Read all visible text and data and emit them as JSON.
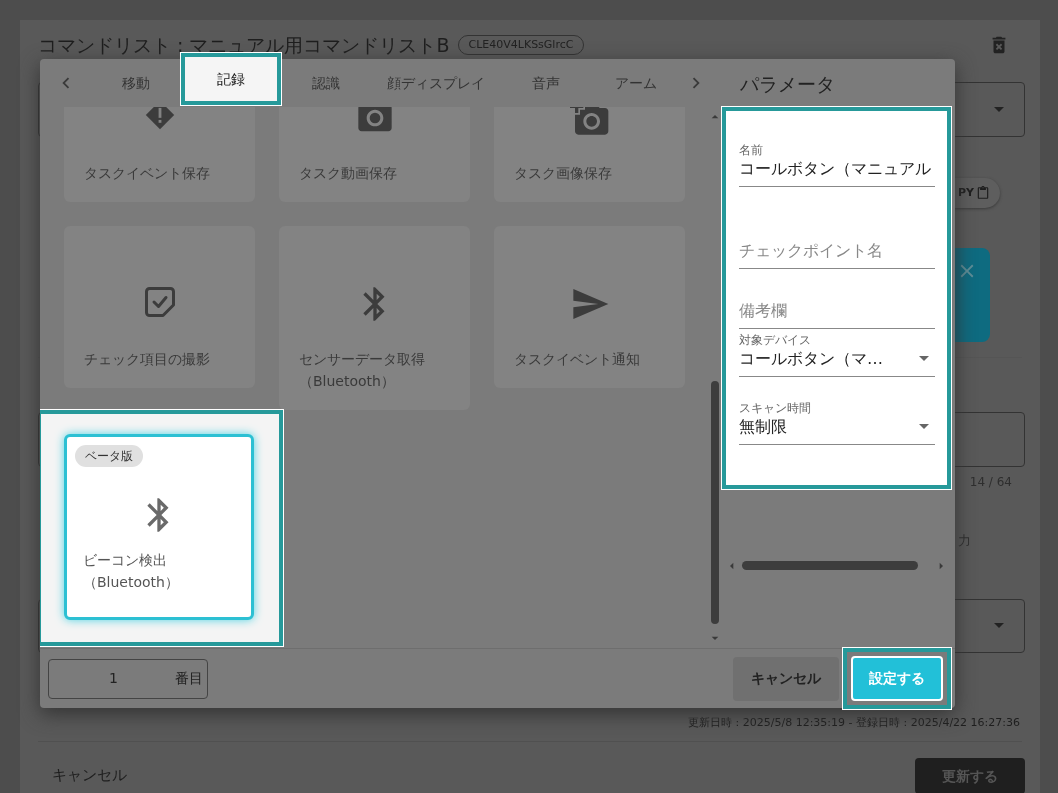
{
  "page": {
    "title": "コマンドリスト : マニュアル用コマンドリストB",
    "id_chip": "CLE40V4LKSsGlrcC",
    "copy_chip": "PY",
    "char_count": "14 / 64",
    "partial_label": "力",
    "timestamps": "更新日時 : 2025/5/8 12:35:19 - 登録日時 : 2025/4/22 16:27:36",
    "cancel_link": "キャンセル",
    "update_button": "更新する"
  },
  "dialog": {
    "tabs": [
      {
        "label": "移動",
        "selected": false
      },
      {
        "label": "記録",
        "selected": true
      },
      {
        "label": "認識",
        "selected": false
      },
      {
        "label": "顔ディスプレイ",
        "selected": false
      },
      {
        "label": "音声",
        "selected": false
      },
      {
        "label": "アーム",
        "selected": false
      }
    ],
    "commands": [
      {
        "label_lines": [
          "タスクイベント保存"
        ],
        "kind": "alert",
        "selected": false
      },
      {
        "label_lines": [
          "タスク動画保存"
        ],
        "kind": "camera",
        "selected": false
      },
      {
        "label_lines": [
          "タスク画像保存"
        ],
        "kind": "camera_add",
        "selected": false
      },
      {
        "label_lines": [
          "チェック項目の撮影"
        ],
        "kind": "check_note",
        "selected": false
      },
      {
        "label_lines": [
          "センサーデータ取得",
          "（Bluetooth）"
        ],
        "kind": "bluetooth",
        "selected": false
      },
      {
        "label_lines": [
          "タスクイベント通知"
        ],
        "kind": "send",
        "selected": false
      },
      {
        "label_lines": [
          "ビーコン検出",
          "（Bluetooth）"
        ],
        "kind": "bluetooth",
        "selected": true,
        "badge": "ベータ版"
      }
    ],
    "parameters": {
      "title": "パラメータ",
      "fields": [
        {
          "kind": "text",
          "label": "名前",
          "value": "コールボタン（マニュアル"
        },
        {
          "kind": "text",
          "placeholder": "チェックポイント名"
        },
        {
          "kind": "text",
          "placeholder": "備考欄"
        },
        {
          "kind": "select",
          "label": "対象デバイス",
          "value": "コールボタン（マ…"
        },
        {
          "kind": "select",
          "label": "スキャン時間",
          "value": "無制限"
        }
      ]
    },
    "position": {
      "value": "1",
      "suffix": "番目"
    },
    "cancel_button": "キャンセル",
    "confirm_button": "設定する"
  }
}
